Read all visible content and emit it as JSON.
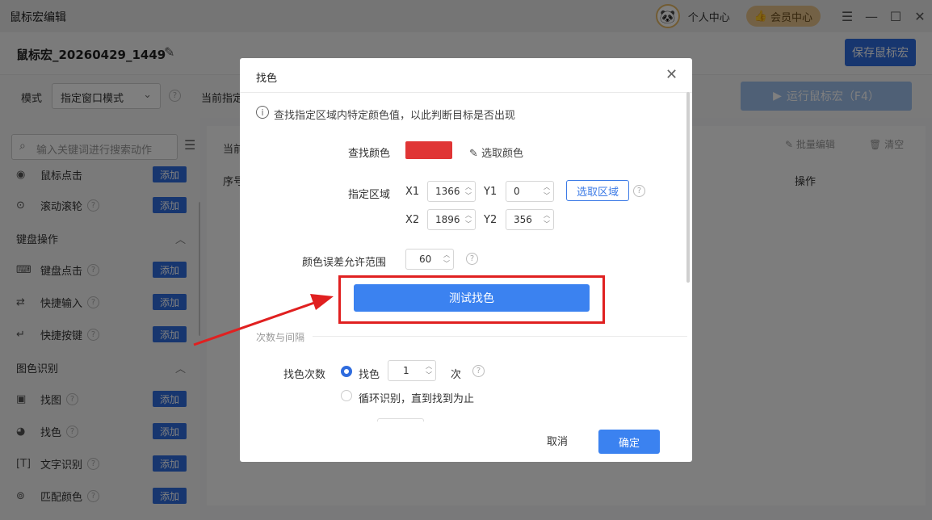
{
  "app": {
    "title": "鼠标宏编辑",
    "user_center": "个人中心",
    "vip_center": "会员中心",
    "macro_name": "鼠标宏_20260429_1449",
    "save_label": "保存鼠标宏",
    "mode_label": "模式",
    "mode_value": "指定窗口模式",
    "current_label": "当前指定",
    "run_label": "运行鼠标宏（F4）"
  },
  "sidebar": {
    "search_placeholder": "输入关键词进行搜索动作",
    "add_label": "添加",
    "items_top": [
      {
        "label": "鼠标点击"
      },
      {
        "label": "滚动滚轮"
      }
    ],
    "groups": [
      {
        "title": "键盘操作",
        "items": [
          {
            "label": "键盘点击"
          },
          {
            "label": "快捷输入"
          },
          {
            "label": "快捷按键"
          }
        ]
      },
      {
        "title": "图色识别",
        "items": [
          {
            "label": "找图"
          },
          {
            "label": "找色"
          },
          {
            "label": "文字识别"
          },
          {
            "label": "匹配颜色"
          }
        ]
      }
    ]
  },
  "main": {
    "top_label": "当前",
    "batch_edit": "批量编辑",
    "clear": "清空",
    "col_seq": "序号",
    "col_op": "操作"
  },
  "modal": {
    "title": "找色",
    "info": "查找指定区域内特定颜色值，以此判断目标是否出现",
    "find_color_label": "查找颜色",
    "pick_color": "选取颜色",
    "color": "#e03535",
    "area_label": "指定区域",
    "x1_label": "X1",
    "x1": "1366",
    "y1_label": "Y1",
    "y1": "0",
    "x2_label": "X2",
    "x2": "1896",
    "y2_label": "Y2",
    "y2": "356",
    "pick_area": "选取区域",
    "tolerance_label": "颜色误差允许范围",
    "tolerance": "60",
    "test_btn": "测试找色",
    "section_title": "次数与间隔",
    "count_label": "找色次数",
    "opt_find": "找色",
    "count": "1",
    "count_unit": "次",
    "opt_loop": "循环识别，直到找到为止",
    "cancel": "取消",
    "ok": "确定"
  }
}
